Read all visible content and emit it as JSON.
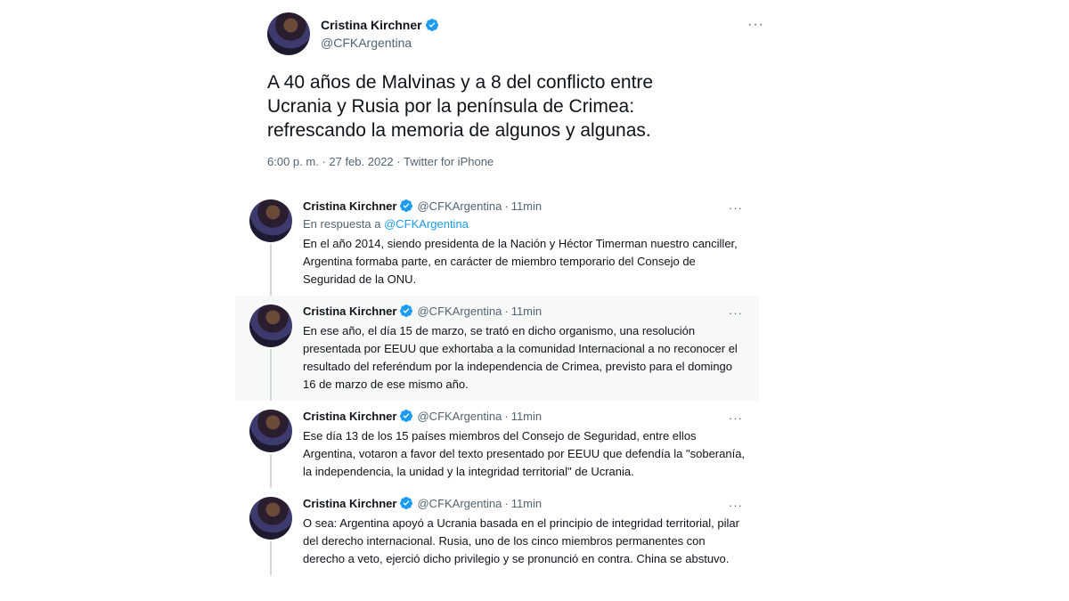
{
  "main_tweet": {
    "display_name": "Cristina Kirchner",
    "handle": "@CFKArgentina",
    "more_label": "···",
    "text": "A 40 años de Malvinas y a 8 del conflicto entre Ucrania y Rusia por la península de Crimea: refrescando la memoria de algunos y algunas.",
    "time": "6:00 p. m.",
    "date": "27 feb. 2022",
    "source": "Twitter for iPhone",
    "separator": " · "
  },
  "colors": {
    "verified": "#1d9bf0",
    "link": "#1d9bf0",
    "secondary_text": "#536471",
    "thread_line": "#cfd9de",
    "shaded_bg": "#f7f9f9"
  },
  "thread": {
    "dot": "·",
    "more_label": "···",
    "replies": [
      {
        "display_name": "Cristina Kirchner",
        "handle": "@CFKArgentina",
        "time": "11min",
        "in_reply_prefix": "En respuesta a ",
        "in_reply_mention": "@CFKArgentina",
        "text": "En el año 2014, siendo presidenta de la Nación y Héctor Timerman nuestro canciller, Argentina formaba parte, en carácter de miembro temporario del Consejo de Seguridad de la ONU."
      },
      {
        "display_name": "Cristina Kirchner",
        "handle": "@CFKArgentina",
        "time": "11min",
        "text": "En ese año, el día 15 de marzo, se trató en dicho organismo, una resolución presentada por EEUU que exhortaba a la comunidad Internacional a no reconocer el resultado del referéndum por la independencia de Crimea, previsto para el domingo 16 de marzo de ese mismo año."
      },
      {
        "display_name": "Cristina Kirchner",
        "handle": "@CFKArgentina",
        "time": "11min",
        "text": "Ese día 13 de los 15 países miembros del Consejo de Seguridad, entre ellos Argentina, votaron a favor del texto presentado por EEUU que defendía la \"soberanía, la independencia, la unidad y la integridad territorial\" de Ucrania."
      },
      {
        "display_name": "Cristina Kirchner",
        "handle": "@CFKArgentina",
        "time": "11min",
        "text": "O sea: Argentina apoyó a Ucrania basada en el principio de integridad territorial, pilar del derecho internacional. Rusia, uno de los cinco miembros permanentes con derecho a veto, ejerció dicho privilegio y se pronunció en contra. China se abstuvo."
      }
    ]
  }
}
